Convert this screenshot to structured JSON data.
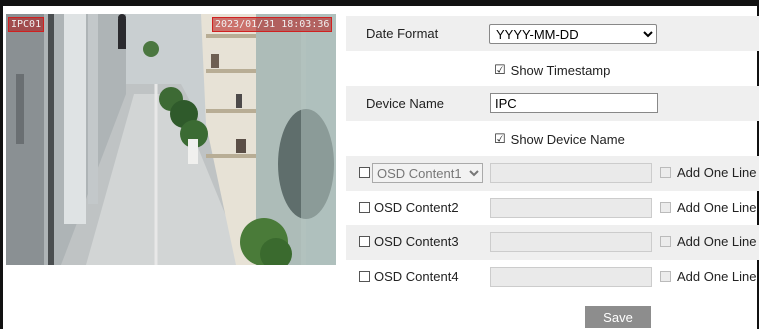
{
  "preview": {
    "osd_left_text": "IPC01",
    "osd_right_text": "2023/01/31 18:03:36"
  },
  "date_format": {
    "label": "Date Format",
    "selected": "YYYY-MM-DD"
  },
  "show_timestamp": {
    "label": "Show Timestamp",
    "checked": true
  },
  "device_name": {
    "label": "Device Name",
    "value": "IPC"
  },
  "show_device_name": {
    "label": "Show Device Name",
    "checked": true
  },
  "osd_contents": [
    {
      "label": "OSD Content1",
      "is_select": true,
      "add_one_line": "Add One Line"
    },
    {
      "label": "OSD Content2",
      "is_select": false,
      "add_one_line": "Add One Line"
    },
    {
      "label": "OSD Content3",
      "is_select": false,
      "add_one_line": "Add One Line"
    },
    {
      "label": "OSD Content4",
      "is_select": false,
      "add_one_line": "Add One Line"
    }
  ],
  "save_label": "Save",
  "checkmark": "☑"
}
